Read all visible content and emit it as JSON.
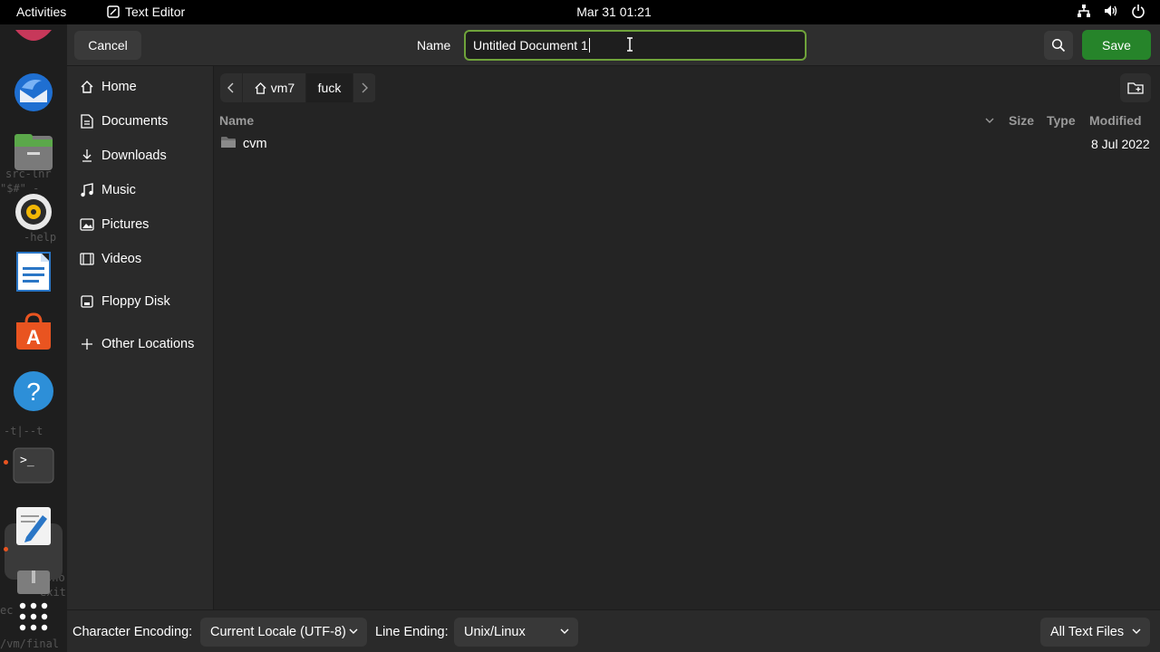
{
  "topbar": {
    "activities": "Activities",
    "app_name": "Text Editor",
    "clock": "Mar 31  01:21",
    "icons": [
      "network-icon",
      "volume-icon",
      "power-icon"
    ]
  },
  "dock": {
    "apps": [
      "ubuntu-icon",
      "thunderbird-icon",
      "files-icon",
      "rhythmbox-icon",
      "libreoffice-writer-icon",
      "app-center-icon",
      "help-icon",
      "terminal-icon",
      "text-editor-icon",
      "archive-icon",
      "show-apps-icon"
    ],
    "ghost_text": [
      "src-lnr",
      "\"$#\" -",
      "-help",
      "ec",
      "/vm/final",
      "-t|--t",
      "sho",
      "exit"
    ]
  },
  "header": {
    "cancel_label": "Cancel",
    "name_label": "Name",
    "filename_value": "Untitled Document 1",
    "save_label": "Save"
  },
  "sidebar": {
    "items": [
      {
        "label": "Home",
        "icon": "home-icon"
      },
      {
        "label": "Documents",
        "icon": "document-icon"
      },
      {
        "label": "Downloads",
        "icon": "download-icon"
      },
      {
        "label": "Music",
        "icon": "music-icon"
      },
      {
        "label": "Pictures",
        "icon": "picture-icon"
      },
      {
        "label": "Videos",
        "icon": "video-icon"
      },
      {
        "label": "Floppy Disk",
        "icon": "floppy-disk-icon"
      },
      {
        "label": "Other Locations",
        "icon": "plus-icon"
      }
    ]
  },
  "pathbar": {
    "segments": [
      "vm7",
      "fuck"
    ]
  },
  "filelist": {
    "columns": [
      "Name",
      "Size",
      "Type",
      "Modified"
    ],
    "rows": [
      {
        "name": "cvm",
        "size": "",
        "type": "",
        "modified": "8 Jul 2022"
      }
    ]
  },
  "bottombar": {
    "encoding_label": "Character Encoding:",
    "encoding_value": "Current Locale (UTF-8)",
    "line_ending_label": "Line Ending:",
    "line_ending_value": "Unix/Linux",
    "filter_value": "All Text Files"
  },
  "colors": {
    "accent_green": "#26842a",
    "focus_border": "#6fa33a",
    "dock_dot": "#e95420"
  }
}
